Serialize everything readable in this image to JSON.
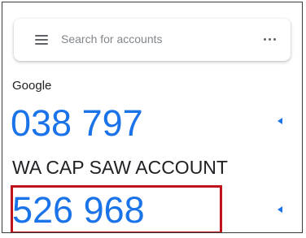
{
  "search": {
    "placeholder": "Search for accounts"
  },
  "accounts": [
    {
      "issuer": "Google",
      "code": "038 797"
    },
    {
      "name": "WA CAP SAW ACCOUNT",
      "code": "526 968"
    }
  ],
  "icons": {
    "menu": "hamburger-menu-icon",
    "more": "more-horizontal-icon",
    "timer": "countdown-timer-icon"
  },
  "colors": {
    "code": "#1a73e8",
    "highlight": "#c0131b",
    "text": "#202124",
    "placeholder": "#80868b"
  }
}
